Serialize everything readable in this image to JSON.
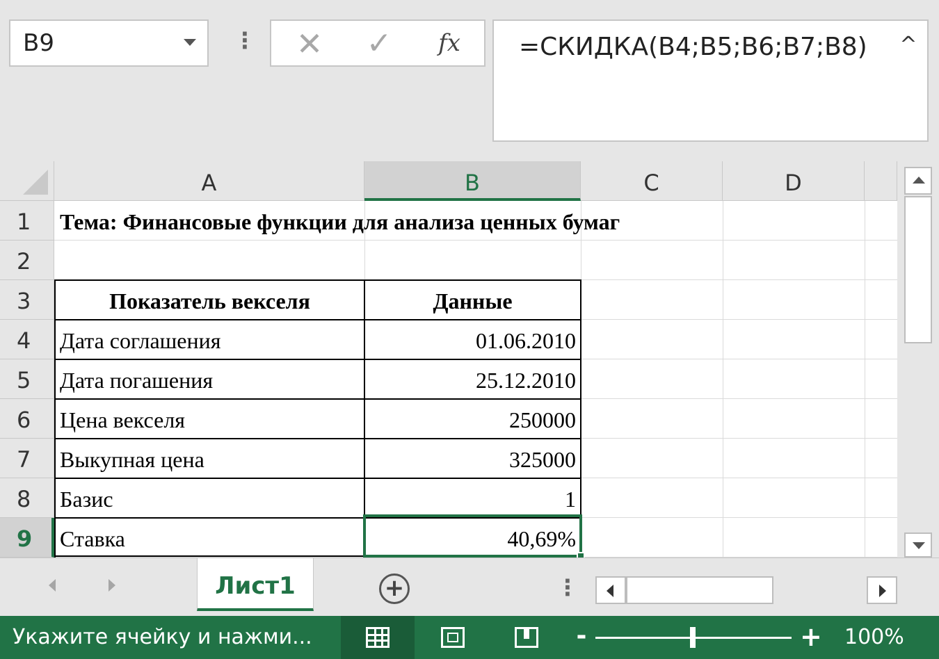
{
  "formula_bar": {
    "name_box": "B9",
    "cancel_symbol": "✕",
    "enter_symbol": "✓",
    "fx_label": "fx",
    "formula": "=СКИДКА(B4;B5;B6;B7;B8)",
    "collapse_symbol": "^"
  },
  "sheet": {
    "columns": [
      "A",
      "B",
      "C",
      "D"
    ],
    "selected_column": "B",
    "rows": [
      "1",
      "2",
      "3",
      "4",
      "5",
      "6",
      "7",
      "8",
      "9"
    ],
    "selected_row": "9",
    "cells": {
      "A1": "Тема: Финансовые функции для анализа ценных бумаг",
      "A3": "Показатель векселя",
      "B3": "Данные",
      "A4": "Дата соглашения",
      "B4": "01.06.2010",
      "A5": "Дата погашения",
      "B5": "25.12.2010",
      "A6": "Цена векселя",
      "B6": "250000",
      "A7": "Выкупная цена",
      "B7": "325000",
      "A8": "Базис",
      "B8": "1",
      "A9": "Ставка",
      "B9": "40,69%"
    },
    "active_cell": "B9"
  },
  "tabs": {
    "active": "Лист1",
    "add_symbol": "+"
  },
  "status_bar": {
    "message": "Укажите ячейку и нажми...",
    "zoom_level": "100%",
    "zoom_minus": "-",
    "zoom_plus": "+"
  },
  "colors": {
    "accent": "#217346",
    "header_bg": "#e6e6e6",
    "gridline": "#dadada"
  },
  "icons": [
    "chevron-down-icon",
    "cancel-icon",
    "enter-icon",
    "fx-icon",
    "collapse-icon",
    "add-sheet-icon",
    "normal-view-icon",
    "page-layout-icon",
    "page-break-icon"
  ]
}
